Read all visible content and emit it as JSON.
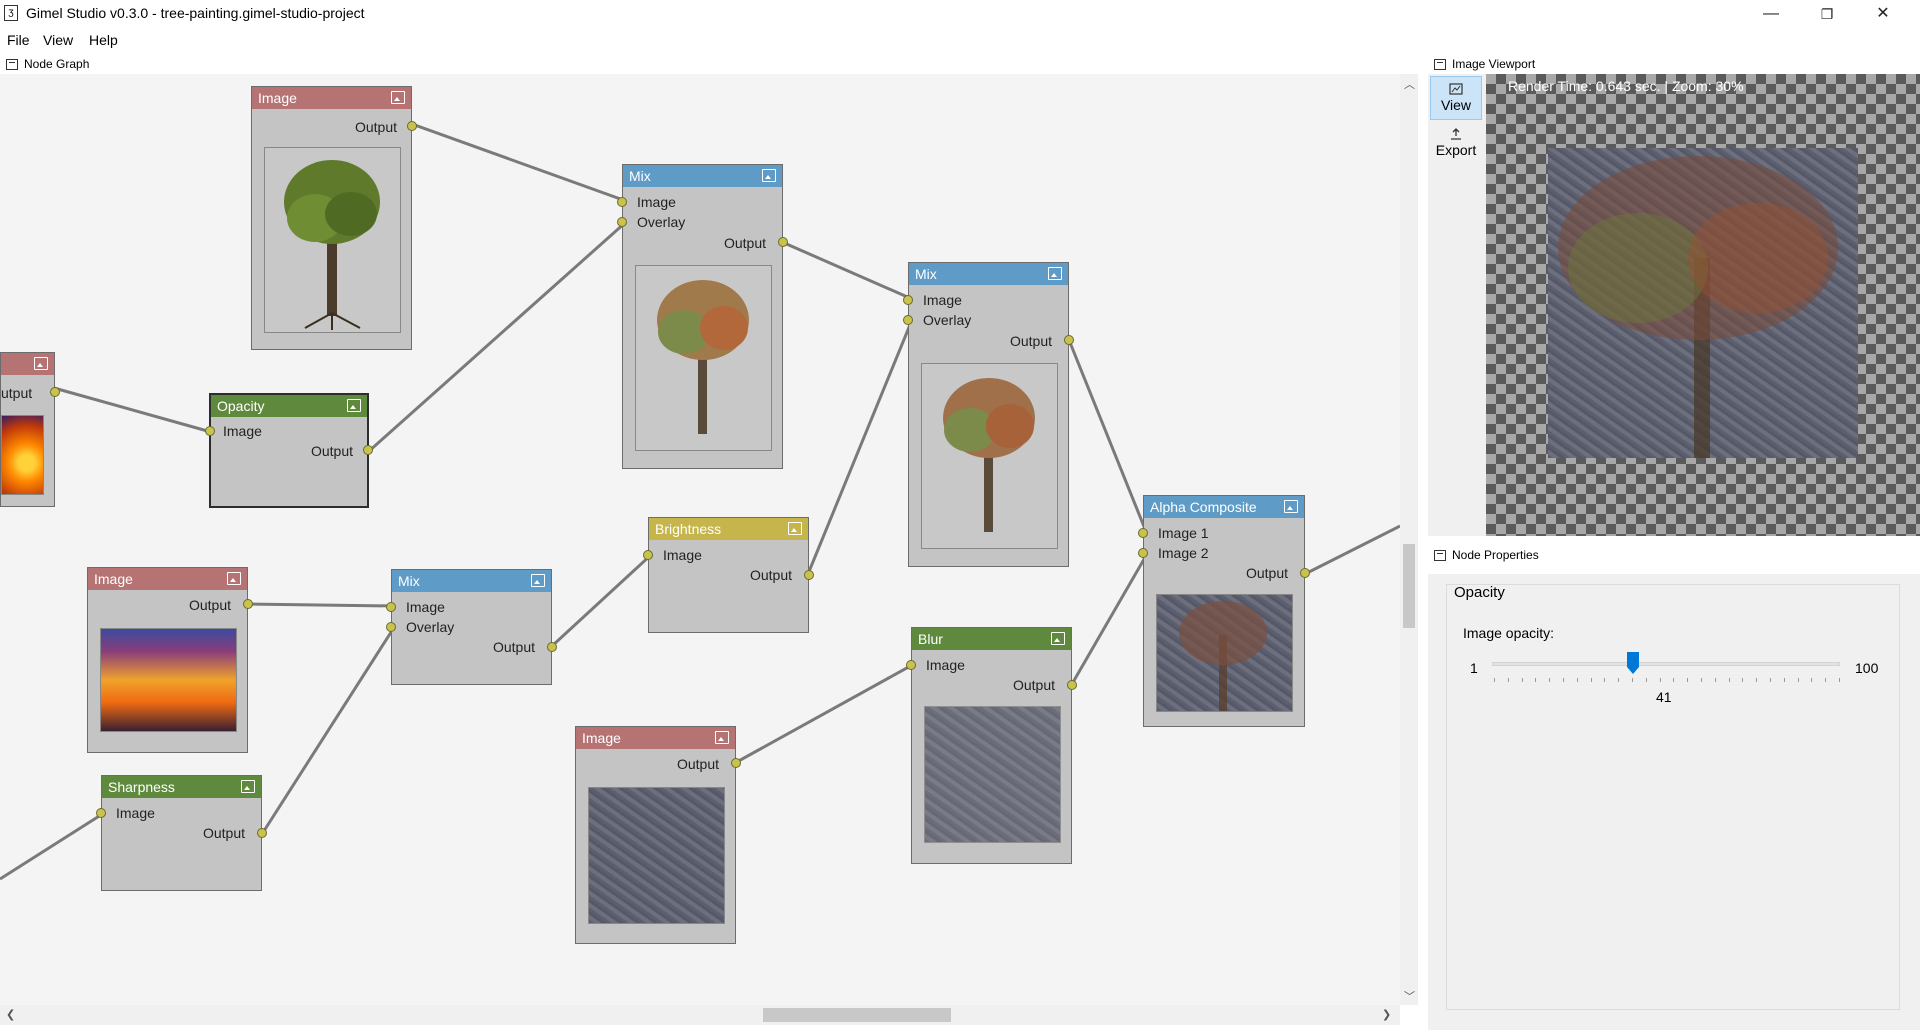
{
  "window": {
    "title": "Gimel Studio v0.3.0 - tree-painting.gimel-studio-project",
    "minimize_glyph": "—",
    "maximize_glyph": "❐",
    "close_glyph": "✕"
  },
  "menu": {
    "items": [
      "File",
      "View",
      "Help"
    ]
  },
  "node_graph": {
    "title": "Node Graph",
    "nodes": {
      "image_tree": {
        "title": "Image",
        "output": "Output"
      },
      "partial_left": {
        "output": "utput"
      },
      "opacity": {
        "title": "Opacity",
        "input": "Image",
        "output": "Output"
      },
      "mix1": {
        "title": "Mix",
        "input1": "Image",
        "input2": "Overlay",
        "output": "Output"
      },
      "mix2": {
        "title": "Mix",
        "input1": "Image",
        "input2": "Overlay",
        "output": "Output"
      },
      "image_sunset": {
        "title": "Image",
        "output": "Output"
      },
      "mix3": {
        "title": "Mix",
        "input1": "Image",
        "input2": "Overlay",
        "output": "Output"
      },
      "brightness": {
        "title": "Brightness",
        "input": "Image",
        "output": "Output"
      },
      "sharpness": {
        "title": "Sharpness",
        "input": "Image",
        "output": "Output"
      },
      "image_texture": {
        "title": "Image",
        "output": "Output"
      },
      "blur": {
        "title": "Blur",
        "input": "Image",
        "output": "Output"
      },
      "alpha_composite": {
        "title": "Alpha Composite",
        "input1": "Image 1",
        "input2": "Image 2",
        "output": "Output"
      }
    }
  },
  "viewport": {
    "title": "Image Viewport",
    "view_label": "View",
    "export_label": "Export",
    "render_info": "Render Time: 0.643 sec. | Zoom: 30%"
  },
  "properties": {
    "title": "Node Properties",
    "group_label": "Opacity",
    "field_label": "Image opacity:",
    "slider_min": "1",
    "slider_max": "100",
    "slider_value": "41"
  },
  "colors": {
    "image_node": "#b57373",
    "mix_node": "#5e9bc6",
    "filter_node": "#5f8a3d",
    "brightness_node": "#c6b54a",
    "port": "#c9c24d",
    "accent": "#0078d7"
  },
  "icons": [
    "app-icon",
    "node-graph-icon",
    "image-viewport-icon",
    "node-properties-icon",
    "view-icon",
    "export-icon",
    "node-image-icon"
  ]
}
